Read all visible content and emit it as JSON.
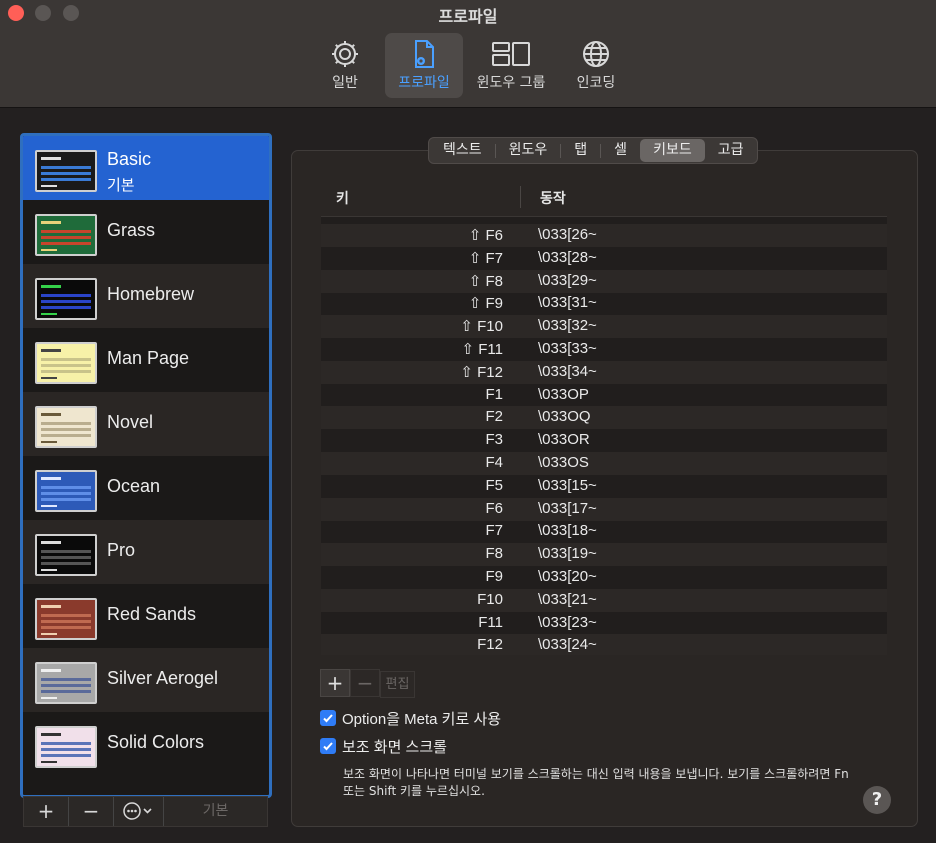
{
  "window": {
    "title": "프로파일"
  },
  "toolbar": {
    "items": [
      {
        "label": "일반",
        "icon": "gear-icon",
        "active": false
      },
      {
        "label": "프로파일",
        "icon": "profile-doc-icon",
        "active": true
      },
      {
        "label": "윈도우 그룹",
        "icon": "window-group-icon",
        "active": false
      },
      {
        "label": "인코딩",
        "icon": "globe-icon",
        "active": false
      }
    ]
  },
  "sidebar": {
    "profiles": [
      {
        "name": "Basic",
        "sub": "기본",
        "selected": true,
        "bg": "#1a1a1a",
        "fg": "#3a7bd5",
        "accent": "#e0e0e0"
      },
      {
        "name": "Grass",
        "sub": "",
        "selected": false,
        "bg": "#1f6b3a",
        "fg": "#c8452c",
        "accent": "#e8d27a"
      },
      {
        "name": "Homebrew",
        "sub": "",
        "selected": false,
        "bg": "#0a0a0a",
        "fg": "#2a44c8",
        "accent": "#35d24a"
      },
      {
        "name": "Man Page",
        "sub": "",
        "selected": false,
        "bg": "#f7f1a8",
        "fg": "#c9c38a",
        "accent": "#444444"
      },
      {
        "name": "Novel",
        "sub": "",
        "selected": false,
        "bg": "#efe6cf",
        "fg": "#b9ad8e",
        "accent": "#6a5a3a"
      },
      {
        "name": "Ocean",
        "sub": "",
        "selected": false,
        "bg": "#2d5ab8",
        "fg": "#5f8ee8",
        "accent": "#e0e8ff"
      },
      {
        "name": "Pro",
        "sub": "",
        "selected": false,
        "bg": "#0a0a0a",
        "fg": "#555555",
        "accent": "#dddddd"
      },
      {
        "name": "Red Sands",
        "sub": "",
        "selected": false,
        "bg": "#8a3a2c",
        "fg": "#c06a50",
        "accent": "#f0d0b0"
      },
      {
        "name": "Silver Aerogel",
        "sub": "",
        "selected": false,
        "bg": "#a8a8a8",
        "fg": "#5a6a9a",
        "accent": "#f0f0f0"
      },
      {
        "name": "Solid Colors",
        "sub": "",
        "selected": false,
        "bg": "#f1e0ea",
        "fg": "#5a74b8",
        "accent": "#333333"
      }
    ],
    "bottom": {
      "add": "+",
      "remove": "−",
      "default": "기본"
    }
  },
  "tabs": {
    "items": [
      {
        "label": "텍스트",
        "active": false
      },
      {
        "label": "윈도우",
        "active": false
      },
      {
        "label": "탭",
        "active": false
      },
      {
        "label": "셀",
        "active": false
      },
      {
        "label": "키보드",
        "active": true
      },
      {
        "label": "고급",
        "active": false
      }
    ]
  },
  "keyboard": {
    "columns": {
      "key": "키",
      "action": "동작"
    },
    "rows": [
      {
        "key": "⇧ F6",
        "action": "\\033[26~"
      },
      {
        "key": "⇧ F7",
        "action": "\\033[28~"
      },
      {
        "key": "⇧ F8",
        "action": "\\033[29~"
      },
      {
        "key": "⇧ F9",
        "action": "\\033[31~"
      },
      {
        "key": "⇧ F10",
        "action": "\\033[32~"
      },
      {
        "key": "⇧ F11",
        "action": "\\033[33~"
      },
      {
        "key": "⇧ F12",
        "action": "\\033[34~"
      },
      {
        "key": "F1",
        "action": "\\033OP"
      },
      {
        "key": "F2",
        "action": "\\033OQ"
      },
      {
        "key": "F3",
        "action": "\\033OR"
      },
      {
        "key": "F4",
        "action": "\\033OS"
      },
      {
        "key": "F5",
        "action": "\\033[15~"
      },
      {
        "key": "F6",
        "action": "\\033[17~"
      },
      {
        "key": "F7",
        "action": "\\033[18~"
      },
      {
        "key": "F8",
        "action": "\\033[19~"
      },
      {
        "key": "F9",
        "action": "\\033[20~"
      },
      {
        "key": "F10",
        "action": "\\033[21~"
      },
      {
        "key": "F11",
        "action": "\\033[23~"
      },
      {
        "key": "F12",
        "action": "\\033[24~"
      }
    ],
    "add": "+",
    "remove": "−",
    "edit": "편집"
  },
  "options": {
    "meta_key": {
      "label": "Option을 Meta 키로 사용",
      "checked": true
    },
    "alt_screen": {
      "label": "보조 화면 스크롤",
      "checked": true
    },
    "description": "보조 화면이 나타나면 터미널 보기를 스크롤하는 대신 입력 내용을 보냅니다. 보기를 스크롤하려면 Fn 또는 Shift 키를 누르십시오."
  },
  "help": "?"
}
